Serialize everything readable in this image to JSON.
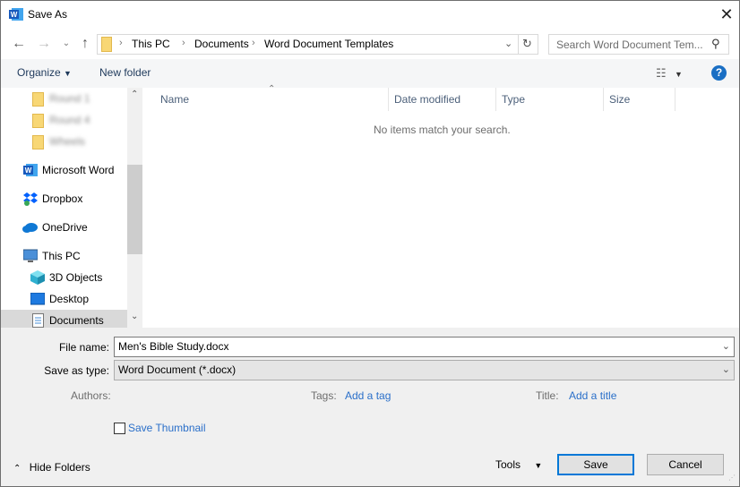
{
  "window": {
    "title": "Save As",
    "app_icon": "word-icon",
    "close_icon": "close-icon"
  },
  "navigation": {
    "back_icon": "back-arrow-icon",
    "forward_icon": "forward-arrow-icon",
    "recent_icon": "chevron-down-icon",
    "up_icon": "up-arrow-icon",
    "breadcrumbs": [
      "This PC",
      "Documents",
      "Word Document Templates"
    ],
    "refresh_icon": "refresh-icon",
    "search_placeholder": "Search Word Document Tem..."
  },
  "toolbar": {
    "organize_label": "Organize",
    "new_folder_label": "New folder",
    "view_icon": "view-details-icon",
    "help_label": "?"
  },
  "sidebar": {
    "items": [
      {
        "label": "Round 1",
        "icon": "folder-icon",
        "blurred": true
      },
      {
        "label": "Round 4",
        "icon": "folder-icon",
        "blurred": true
      },
      {
        "label": "Wheels",
        "icon": "folder-icon",
        "blurred": true
      },
      {
        "label": "Microsoft Word",
        "icon": "word-icon"
      },
      {
        "label": "Dropbox",
        "icon": "dropbox-icon"
      },
      {
        "label": "OneDrive",
        "icon": "onedrive-icon"
      },
      {
        "label": "This PC",
        "icon": "computer-icon"
      },
      {
        "label": "3D Objects",
        "icon": "cube-icon"
      },
      {
        "label": "Desktop",
        "icon": "desktop-icon"
      },
      {
        "label": "Documents",
        "icon": "documents-icon",
        "selected": true
      }
    ]
  },
  "file_list": {
    "columns": [
      "Name",
      "Date modified",
      "Type",
      "Size"
    ],
    "empty_message": "No items match your search."
  },
  "form": {
    "file_name_label": "File name:",
    "file_name_value": "Men's Bible Study.docx",
    "save_as_type_label": "Save as type:",
    "save_as_type_value": "Word Document (*.docx)",
    "authors_label": "Authors:",
    "tags_label": "Tags:",
    "tags_link": "Add a tag",
    "title_label": "Title:",
    "title_link": "Add a title",
    "save_thumbnail_label": "Save Thumbnail",
    "save_thumbnail_checked": false
  },
  "footer": {
    "hide_folders_label": "Hide Folders",
    "tools_label": "Tools",
    "save_label": "Save",
    "cancel_label": "Cancel"
  }
}
